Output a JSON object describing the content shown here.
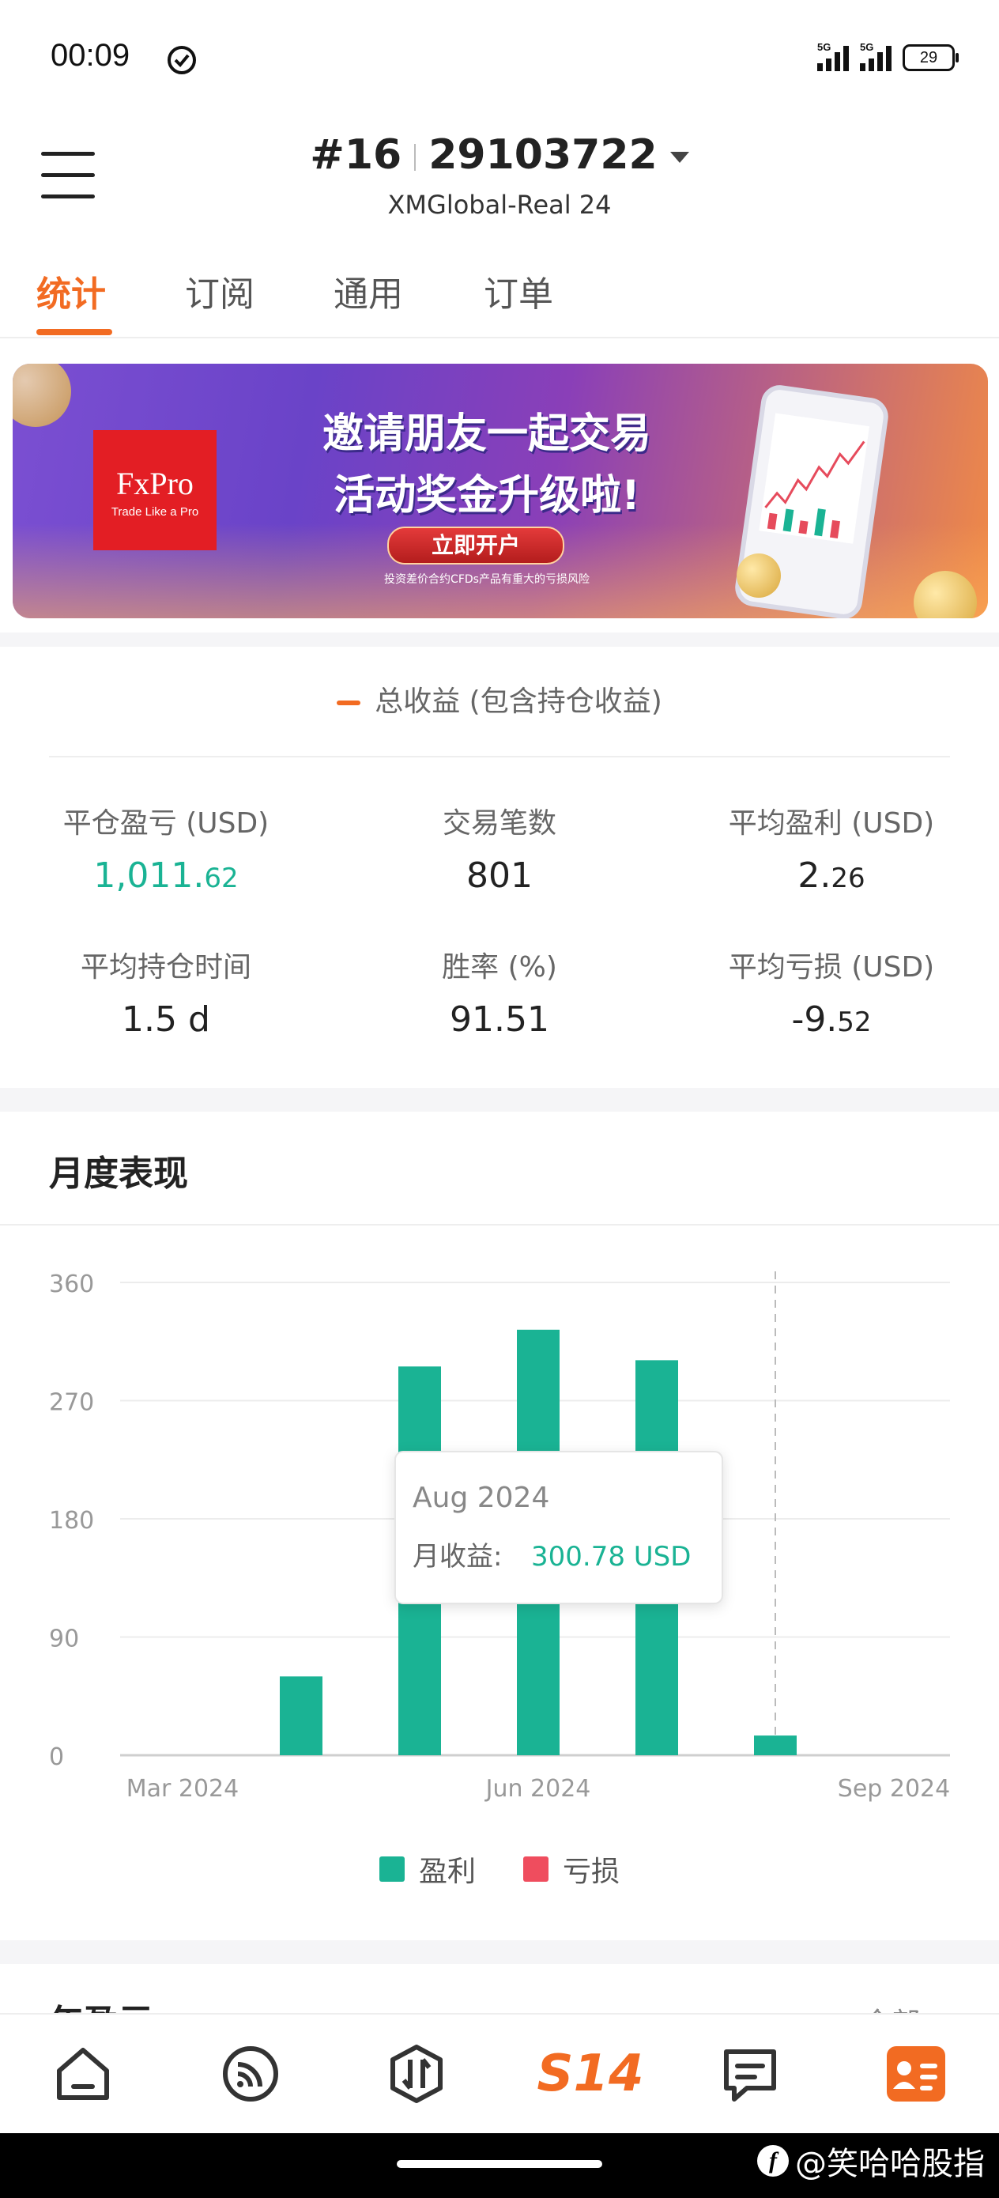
{
  "status_bar": {
    "time": "00:09",
    "network_1": "5G",
    "network_2": "5G",
    "battery": "29"
  },
  "header": {
    "account_index": "#16",
    "account_number": "29103722",
    "server": "XMGlobal-Real 24"
  },
  "tabs": [
    {
      "label": "统计",
      "active": true
    },
    {
      "label": "订阅",
      "active": false
    },
    {
      "label": "通用",
      "active": false
    },
    {
      "label": "订单",
      "active": false
    }
  ],
  "banner": {
    "brand": "FxPro",
    "brand_tagline": "Trade Like a Pro",
    "headline_1": "邀请朋友一起交易",
    "headline_2": "活动奖金升级啦!",
    "cta": "立即开户",
    "disclaimer": "投资差价合约CFDs产品有重大的亏损风险"
  },
  "stats": {
    "section_label": "总收益 (包含持仓收益)",
    "items": [
      {
        "label": "平仓盈亏 (USD)",
        "value_int": "1,011.",
        "value_dec": "62",
        "color": "#1ab394"
      },
      {
        "label": "交易笔数",
        "value_int": "801",
        "value_dec": ""
      },
      {
        "label": "平均盈利 (USD)",
        "value_int": "2.",
        "value_dec": "26"
      },
      {
        "label": "平均持仓时间",
        "value_int": "1.5 d",
        "value_dec": ""
      },
      {
        "label": "胜率 (%)",
        "value_int": "91.51",
        "value_dec": ""
      },
      {
        "label": "平均亏损 (USD)",
        "value_int": "-9.",
        "value_dec": "52"
      }
    ]
  },
  "monthly": {
    "title": "月度表现",
    "tooltip": {
      "month": "Aug 2024",
      "label": "月收益:",
      "value": "300.78 USD"
    },
    "legend": [
      {
        "label": "盈利",
        "color": "#1ab394"
      },
      {
        "label": "亏损",
        "color": "#ef4d5e"
      }
    ]
  },
  "chart_data": {
    "type": "bar",
    "categories": [
      "Mar 2024",
      "Apr 2024",
      "May 2024",
      "Jun 2024",
      "Jul 2024",
      "Aug 2024",
      "Sep 2024"
    ],
    "series": [
      {
        "name": "盈利",
        "values": [
          0,
          60,
          296,
          324,
          300.78,
          15
        ],
        "color": "#1ab394"
      },
      {
        "name": "亏损",
        "values": [
          0,
          0,
          0,
          0,
          0,
          0,
          0
        ],
        "color": "#ef4d5e"
      }
    ],
    "x_tick_labels": [
      "Mar 2024",
      "Jun 2024",
      "Sep 2024"
    ],
    "y_ticks": [
      0,
      90,
      180,
      270,
      360
    ],
    "ylim": [
      0,
      360
    ],
    "grid": true,
    "legend": "bottom",
    "highlighted_category": "Aug 2024"
  },
  "next_section": {
    "title": "年盈亏",
    "right_label": "全部"
  },
  "bottom_nav": {
    "items": [
      {
        "name": "home"
      },
      {
        "name": "feed"
      },
      {
        "name": "trade"
      },
      {
        "name": "s14",
        "label": "S14"
      },
      {
        "name": "messages"
      },
      {
        "name": "profile"
      }
    ]
  },
  "watermark": {
    "text": "@笑哈哈股指"
  }
}
